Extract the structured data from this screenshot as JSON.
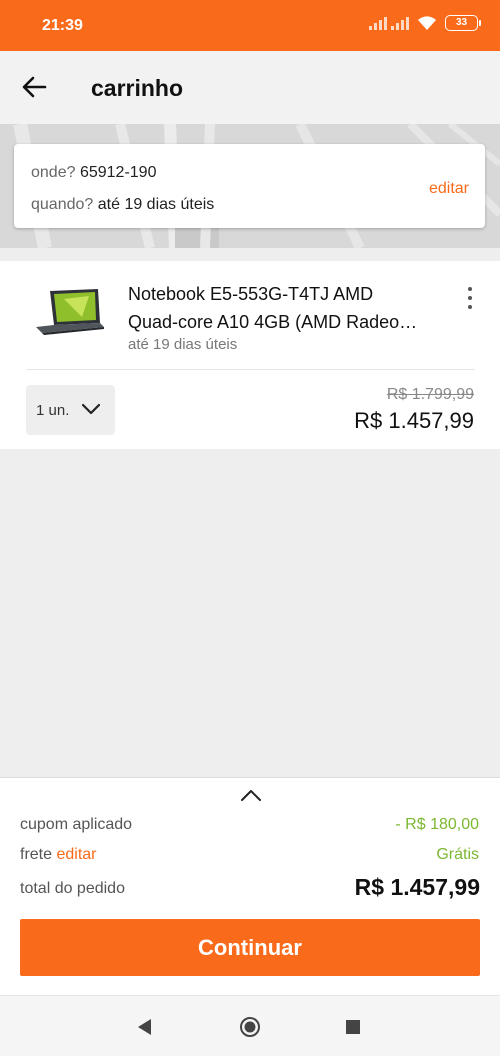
{
  "status_bar": {
    "time": "21:39",
    "battery": "33",
    "icons": [
      "signal-icon",
      "wifi-icon",
      "battery-icon"
    ]
  },
  "header": {
    "title": "carrinho",
    "back_icon": "arrow-back-icon"
  },
  "delivery": {
    "where_label": "onde?",
    "where_value": "65912-190",
    "when_label": "quando?",
    "when_value": "até 19 dias úteis",
    "edit_label": "editar"
  },
  "cart_item": {
    "name_line1": "Notebook E5-553G-T4TJ AMD",
    "name_line2": "Quad-core A10 4GB (AMD Radeo…",
    "eta": "até 19 dias úteis",
    "quantity": "1 un.",
    "old_price": "R$ 1.799,99",
    "price": "R$ 1.457,99",
    "menu_icon": "more-vert-icon"
  },
  "summary": {
    "coupon_label": "cupom aplicado",
    "coupon_value": "- R$ 180,00",
    "shipping_label": "frete",
    "shipping_edit": "editar",
    "shipping_value": "Grátis",
    "total_label": "total do pedido",
    "total_value": "R$ 1.457,99",
    "continue_button": "Continuar"
  },
  "colors": {
    "accent": "#f96b1a",
    "discount_green": "#7cb732",
    "background": "#eeeeee"
  },
  "nav_bar": {
    "icons": [
      "back-triangle-icon",
      "home-circle-icon",
      "recents-square-icon"
    ]
  }
}
